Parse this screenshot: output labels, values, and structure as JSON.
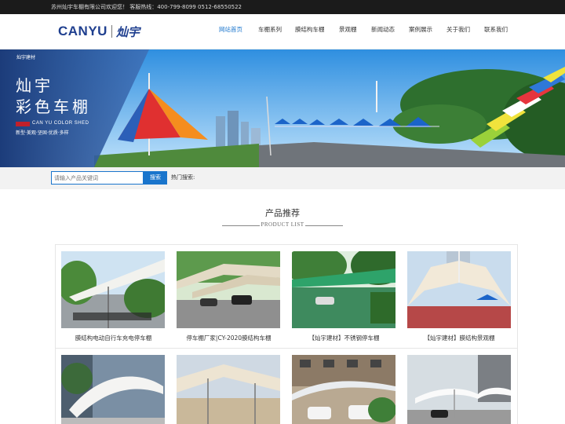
{
  "topbar": {
    "text": "苏州灿宇车棚有限公司欢迎您！ 客服热线：400-799-8099 0512-68550522"
  },
  "logo": {
    "en": "CANYU",
    "cn": "灿宇"
  },
  "nav": [
    {
      "label": "网站首页",
      "active": true
    },
    {
      "label": "车棚系列"
    },
    {
      "label": "膜结构车棚"
    },
    {
      "label": "景观棚"
    },
    {
      "label": "新闻动态"
    },
    {
      "label": "案例展示"
    },
    {
      "label": "关于我们"
    },
    {
      "label": "联系我们"
    }
  ],
  "banner": {
    "brand": "灿宇建材",
    "title_line1": "灿宇",
    "title_line2": "彩色车棚",
    "en": "CAN YU COLOR SHED",
    "slogan": "新型·美观·坚固·优质·多样"
  },
  "search": {
    "placeholder": "请输入产品关键词",
    "button": "搜索",
    "hot_label": "热门搜索:"
  },
  "products_section": {
    "title": "产品推荐",
    "subtitle": "PRODUCT LIST",
    "items": [
      {
        "caption": "膜结构电动自行车充电停车棚",
        "image": "membrane-bike-shed-photo"
      },
      {
        "caption": "停车棚厂家|CY-2020膜结构车棚",
        "image": "membrane-car-shed-photo"
      },
      {
        "caption": "【灿宇建材】不锈钢停车棚",
        "image": "steel-car-shed-photo"
      },
      {
        "caption": "【灿宇建材】膜结构景观棚",
        "image": "landscape-tent-photo"
      },
      {
        "caption": "",
        "image": "white-membrane-shed-photo"
      },
      {
        "caption": "",
        "image": "parking-lot-canopy-photo"
      },
      {
        "caption": "",
        "image": "residential-car-shed-photo"
      },
      {
        "caption": "",
        "image": "cantilever-membrane-shed-photo"
      }
    ]
  },
  "colors": {
    "accent": "#1a75cc",
    "topbar": "#1b1b1b",
    "logo": "#1f3f8f"
  }
}
